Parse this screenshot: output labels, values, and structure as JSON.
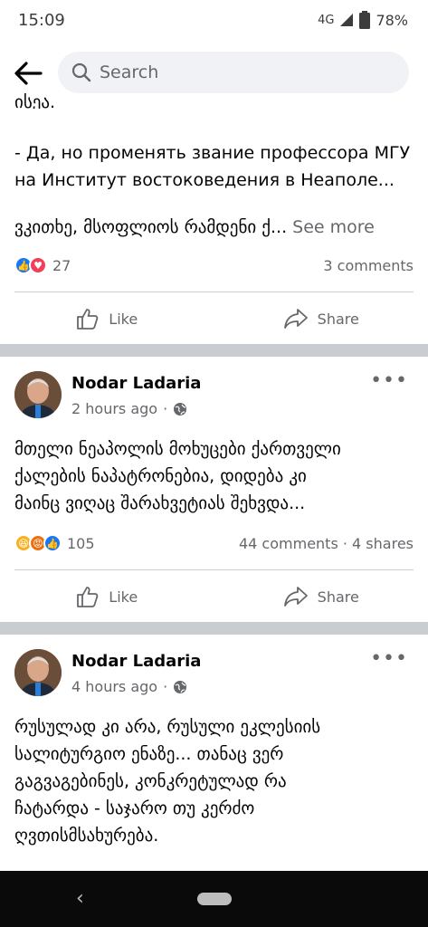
{
  "status": {
    "time": "15:09",
    "network": "4G",
    "battery": "78%"
  },
  "search": {
    "placeholder": "Search"
  },
  "post1": {
    "cut_text": "ისეა.",
    "text_lines": [
      "- Да, но променять звание профессора МГУ",
      "на Институт востоковедения в Неаполе..."
    ],
    "georgian_text": "ვკითხე, მსოფლიოს რამდენი ქ...",
    "see_more": "See more",
    "reaction_count": "27",
    "comments": "3 comments",
    "like_label": "Like",
    "share_label": "Share"
  },
  "post2": {
    "author": "Nodar Ladaria",
    "time": "2 hours ago",
    "text_lines": [
      "მთელი ნეაპოლის მოხუცები ქართველი",
      "ქალების ნაპატრონებია, დიდება კი",
      "მაინც ვიღაც შარახვეტიას შეხვდა..."
    ],
    "reaction_count": "105",
    "comments_shares": "44 comments · 4 shares",
    "like_label": "Like",
    "share_label": "Share"
  },
  "post3": {
    "author": "Nodar Ladaria",
    "time": "4 hours ago",
    "text_lines": [
      "რუსულად კი არა, რუსული ეკლესიის",
      "სალიტურგიო ენაზე... თანაც ვერ",
      "გაგვაგებინეს, კონკრეტულად რა",
      "ჩატარდა - საჯარო თუ კერძო",
      "ღვთისმსახურება."
    ]
  },
  "icons": {
    "back": "arrow-left-icon",
    "search": "search-icon",
    "like": "thumbs-up-icon",
    "share": "share-arrow-icon",
    "globe": "globe-icon",
    "more": "more-horizontal-icon"
  },
  "colors": {
    "like_blue": "#1877f2",
    "love_red": "#f33e58",
    "haha_yellow": "#f7b125",
    "angry_orange": "#e9710f",
    "separator": "#c9ccd1"
  }
}
